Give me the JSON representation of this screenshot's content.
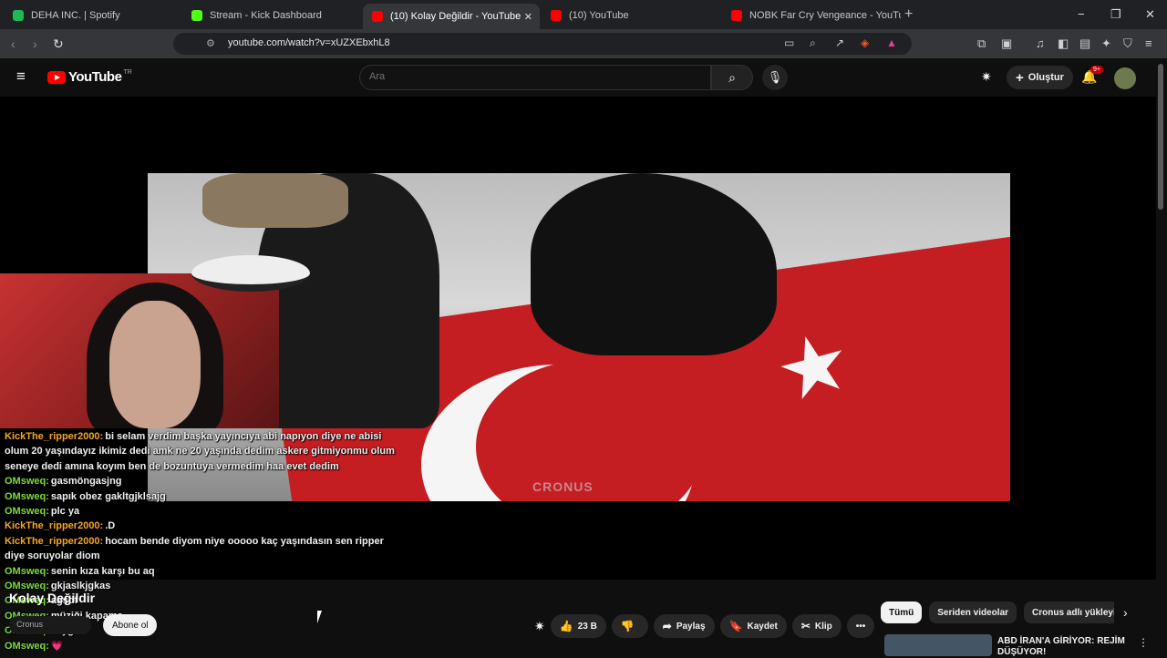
{
  "browser": {
    "tabs": [
      {
        "label": "DEHA INC. | Spotify",
        "color": "#1db954"
      },
      {
        "label": "Stream - Kick Dashboard",
        "color": "#53fc18"
      },
      {
        "label": "(10) Kolay Değildir - YouTube",
        "color": "#ff0000",
        "active": true
      },
      {
        "label": "(10) YouTube",
        "color": "#ff0000"
      },
      {
        "label": "NOBK Far Cry Vengeance - YouTube",
        "color": "#ff0000"
      }
    ],
    "url": "youtube.com/watch?v=xUZXEbxhL8",
    "new_tab": "+",
    "window_controls": {
      "minimize": "−",
      "restore": "❐",
      "close": "✕"
    }
  },
  "youtube": {
    "logo_text": "YouTube",
    "country": "TR",
    "search_placeholder": "Ara",
    "create_label": "Oluştur",
    "notifications": "9+"
  },
  "video": {
    "watermark": "CRONUS",
    "title": "Kolay Değildir",
    "channel": "Cronus",
    "subscribe_label": "Abone ol",
    "likes": "23 B",
    "share_label": "Paylaş",
    "save_label": "Kaydet",
    "clip_label": "Klip"
  },
  "chat": [
    {
      "user": "KickThe_ripper2000:",
      "color": "#f5a623",
      "msg": "bi selam verdim başka yayıncıya abi napıyon diye ne abisi olum 20 yaşındayız ikimiz dedi amk ne 20 yaşında dedim askere gitmiyonmu olum seneye dedi amına koyım ben de bozuntuya vermedim haa evet dedim"
    },
    {
      "user": "OMsweq:",
      "color": "#7ddc3a",
      "msg": "gasmöngasjng"
    },
    {
      "user": "OMsweq:",
      "color": "#7ddc3a",
      "msg": "sapık obez gakltgjklsajg"
    },
    {
      "user": "OMsweq:",
      "color": "#7ddc3a",
      "msg": "plc ya"
    },
    {
      "user": "KickThe_ripper2000:",
      "color": "#f5a623",
      "msg": ".D"
    },
    {
      "user": "KickThe_ripper2000:",
      "color": "#f5a623",
      "msg": "hocam bende diyom niye ooooo kaç yaşındasın sen ripper diye soruyolar diom"
    },
    {
      "user": "OMsweq:",
      "color": "#7ddc3a",
      "msg": "senin kıza karşı bu aq"
    },
    {
      "user": "OMsweq:",
      "color": "#7ddc3a",
      "msg": "gkjaslkjgkas"
    },
    {
      "user": "OMsweq:",
      "color": "#7ddc3a",
      "msg": "agsdf"
    },
    {
      "user": "OMsweq:",
      "color": "#7ddc3a",
      "msg": "müziği kapama"
    },
    {
      "user": "OMsweq:",
      "color": "#7ddc3a",
      "msg": "saygı"
    },
    {
      "user": "OMsweq:",
      "color": "#7ddc3a",
      "msg": "💗"
    }
  ],
  "sidebar": {
    "chips": [
      "Tümü",
      "Seriden videolar",
      "Cronus adlı yükleyici"
    ],
    "recommendation_title": "ABD İRAN'A GİRİYOR: REJİM DÜŞÜYOR!"
  }
}
